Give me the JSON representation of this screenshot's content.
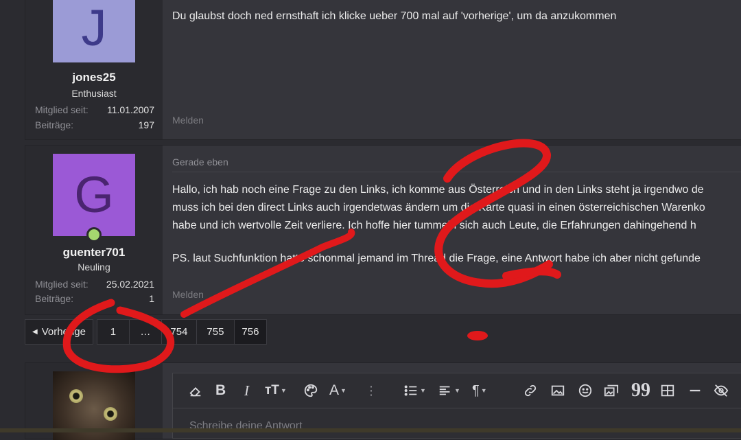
{
  "posts": [
    {
      "avatar_letter": "J",
      "avatar_color": "#9b9bd6",
      "avatar_text_color": "#3d3a8a",
      "username": "jones25",
      "user_title": "Enthusiast",
      "member_since_label": "Mitglied seit:",
      "member_since": "11.01.2007",
      "posts_label": "Beiträge:",
      "posts_count": "197",
      "message_lines": [
        "Du glaubst doch ned ernsthaft ich klicke ueber 700 mal auf 'vorherige', um da anzukommen"
      ],
      "report_label": "Melden"
    },
    {
      "avatar_letter": "G",
      "avatar_color": "#9b59d6",
      "avatar_text_color": "#4a2470",
      "username": "guenter701",
      "user_title": "Neuling",
      "member_since_label": "Mitglied seit:",
      "member_since": "25.02.2021",
      "posts_label": "Beiträge:",
      "posts_count": "1",
      "timestamp": "Gerade eben",
      "message_lines": [
        "Hallo, ich hab noch eine Frage zu den Links, ich komme aus Österreich und in den Links steht ja irgendwo de",
        "muss ich bei den direct Links auch irgendetwas ändern um die Karte quasi in einen österreichischen Warenko",
        "habe und ich wertvolle Zeit verliere. Ich hoffe hier tummeln sich auch Leute, die Erfahrungen dahingehend h",
        "",
        "PS. laut Suchfunktion hatte schonmal jemand im Thread die Frage, eine Antwort habe ich aber nicht gefunde"
      ],
      "report_label": "Melden"
    }
  ],
  "pagination": {
    "prev_label": "Vorherige",
    "pages": [
      "1",
      "…",
      "754",
      "755",
      "756"
    ]
  },
  "editor": {
    "placeholder": "Schreibe deine Antwort",
    "toolbar_icons": [
      "eraser-icon",
      "bold-icon",
      "italic-icon",
      "text-size-icon",
      "palette-icon",
      "font-color-icon",
      "more-vertical-icon",
      "list-icon",
      "align-icon",
      "paragraph-icon",
      "link-icon",
      "image-icon",
      "smiley-icon",
      "media-icon",
      "quote-icon",
      "table-icon",
      "horizontal-rule-icon",
      "spoiler-icon"
    ]
  },
  "colors": {
    "annotation_red": "#e0191b",
    "online_green": "#a5d66f"
  }
}
